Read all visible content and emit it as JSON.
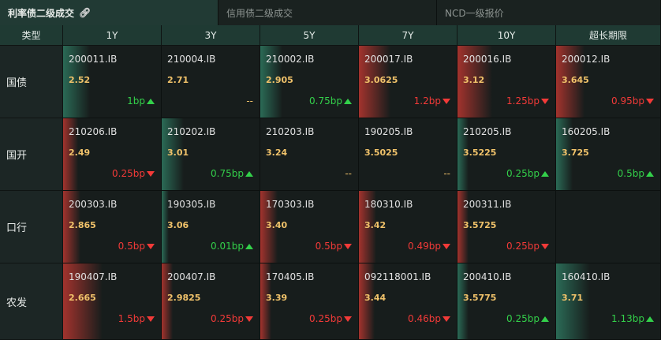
{
  "tabs": [
    {
      "label": "利率债二级成交",
      "active": true,
      "icon": "link-icon"
    },
    {
      "label": "信用债二级成交",
      "active": false
    },
    {
      "label": "NCD一级报价",
      "active": false
    }
  ],
  "table": {
    "corner_label": "类型",
    "columns": [
      "1Y",
      "3Y",
      "5Y",
      "7Y",
      "10Y",
      "超长期限"
    ],
    "rows": [
      {
        "label": "国债",
        "cells": [
          {
            "code": "200011.IB",
            "yield": "2.52",
            "change": "1bp",
            "dir": "up",
            "level": 0.45
          },
          {
            "code": "210004.IB",
            "yield": "2.71",
            "change": "--",
            "dir": "flat",
            "level": 0
          },
          {
            "code": "210002.IB",
            "yield": "2.905",
            "change": "0.75bp",
            "dir": "up",
            "level": 0.35
          },
          {
            "code": "200017.IB",
            "yield": "3.0625",
            "change": "1.2bp",
            "dir": "down",
            "level": 0.55
          },
          {
            "code": "200016.IB",
            "yield": "3.12",
            "change": "1.25bp",
            "dir": "down",
            "level": 0.6
          },
          {
            "code": "200012.IB",
            "yield": "3.645",
            "change": "0.95bp",
            "dir": "down",
            "level": 0.45
          }
        ]
      },
      {
        "label": "国开",
        "cells": [
          {
            "code": "210206.IB",
            "yield": "2.49",
            "change": "0.25bp",
            "dir": "down",
            "level": 0.2
          },
          {
            "code": "210202.IB",
            "yield": "3.01",
            "change": "0.75bp",
            "dir": "up",
            "level": 0.35
          },
          {
            "code": "210203.IB",
            "yield": "3.24",
            "change": "--",
            "dir": "flat",
            "level": 0
          },
          {
            "code": "190205.IB",
            "yield": "3.5025",
            "change": "--",
            "dir": "flat",
            "level": 0
          },
          {
            "code": "210205.IB",
            "yield": "3.5225",
            "change": "0.25bp",
            "dir": "up",
            "level": 0.12
          },
          {
            "code": "160205.IB",
            "yield": "3.725",
            "change": "0.5bp",
            "dir": "up",
            "level": 0.22
          }
        ]
      },
      {
        "label": "口行",
        "cells": [
          {
            "code": "200303.IB",
            "yield": "2.865",
            "change": "0.5bp",
            "dir": "down",
            "level": 0.25
          },
          {
            "code": "190305.IB",
            "yield": "3.06",
            "change": "0.01bp",
            "dir": "up",
            "level": 0.05
          },
          {
            "code": "170303.IB",
            "yield": "3.40",
            "change": "0.5bp",
            "dir": "down",
            "level": 0.25
          },
          {
            "code": "180310.IB",
            "yield": "3.42",
            "change": "0.49bp",
            "dir": "down",
            "level": 0.25
          },
          {
            "code": "200311.IB",
            "yield": "3.5725",
            "change": "0.25bp",
            "dir": "down",
            "level": 0.12
          },
          {
            "empty": true
          }
        ]
      },
      {
        "label": "农发",
        "cells": [
          {
            "code": "190407.IB",
            "yield": "2.665",
            "change": "1.5bp",
            "dir": "down",
            "level": 0.7
          },
          {
            "code": "200407.IB",
            "yield": "2.9825",
            "change": "0.25bp",
            "dir": "down",
            "level": 0.12
          },
          {
            "code": "170405.IB",
            "yield": "3.39",
            "change": "0.25bp",
            "dir": "down",
            "level": 0.12
          },
          {
            "code": "092118001.IB",
            "yield": "3.44",
            "change": "0.46bp",
            "dir": "down",
            "level": 0.22
          },
          {
            "code": "200410.IB",
            "yield": "3.5775",
            "change": "0.25bp",
            "dir": "up",
            "level": 0.12
          },
          {
            "code": "160410.IB",
            "yield": "3.71",
            "change": "1.13bp",
            "dir": "up",
            "level": 0.55
          }
        ]
      }
    ]
  }
}
